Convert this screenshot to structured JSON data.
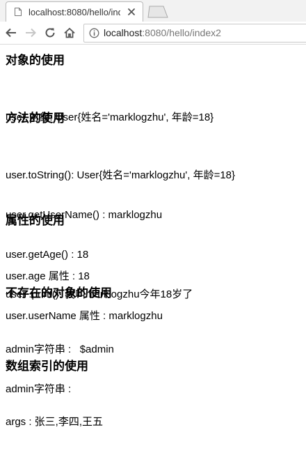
{
  "browser": {
    "tab_title": "localhost:8080/hello/inde",
    "url_host": "localhost",
    "url_rest": ":8080/hello/index2"
  },
  "sections": [
    {
      "heading": "对象的使用",
      "lines": [
        "user 对象: User{姓名='marklogzhu', 年龄=18}"
      ]
    },
    {
      "heading": "方法的使用",
      "lines": [
        "user.toString(): User{姓名='marklogzhu', 年龄=18}",
        "user.getUserName() : marklogzhu",
        "user.getAge() : 18",
        "user .print(): 我叫marklogzhu今年18岁了"
      ]
    },
    {
      "heading": "属性的使用",
      "lines": [
        "user.age 属性 : 18",
        "user.userName 属性 : marklogzhu"
      ]
    },
    {
      "heading": "不存在的对象的使用",
      "lines": [
        "admin字符串 :   $admin",
        "admin字符串 :"
      ]
    },
    {
      "heading": "数组索引的使用",
      "lines": [
        "args : 张三,李四,王五"
      ]
    }
  ]
}
